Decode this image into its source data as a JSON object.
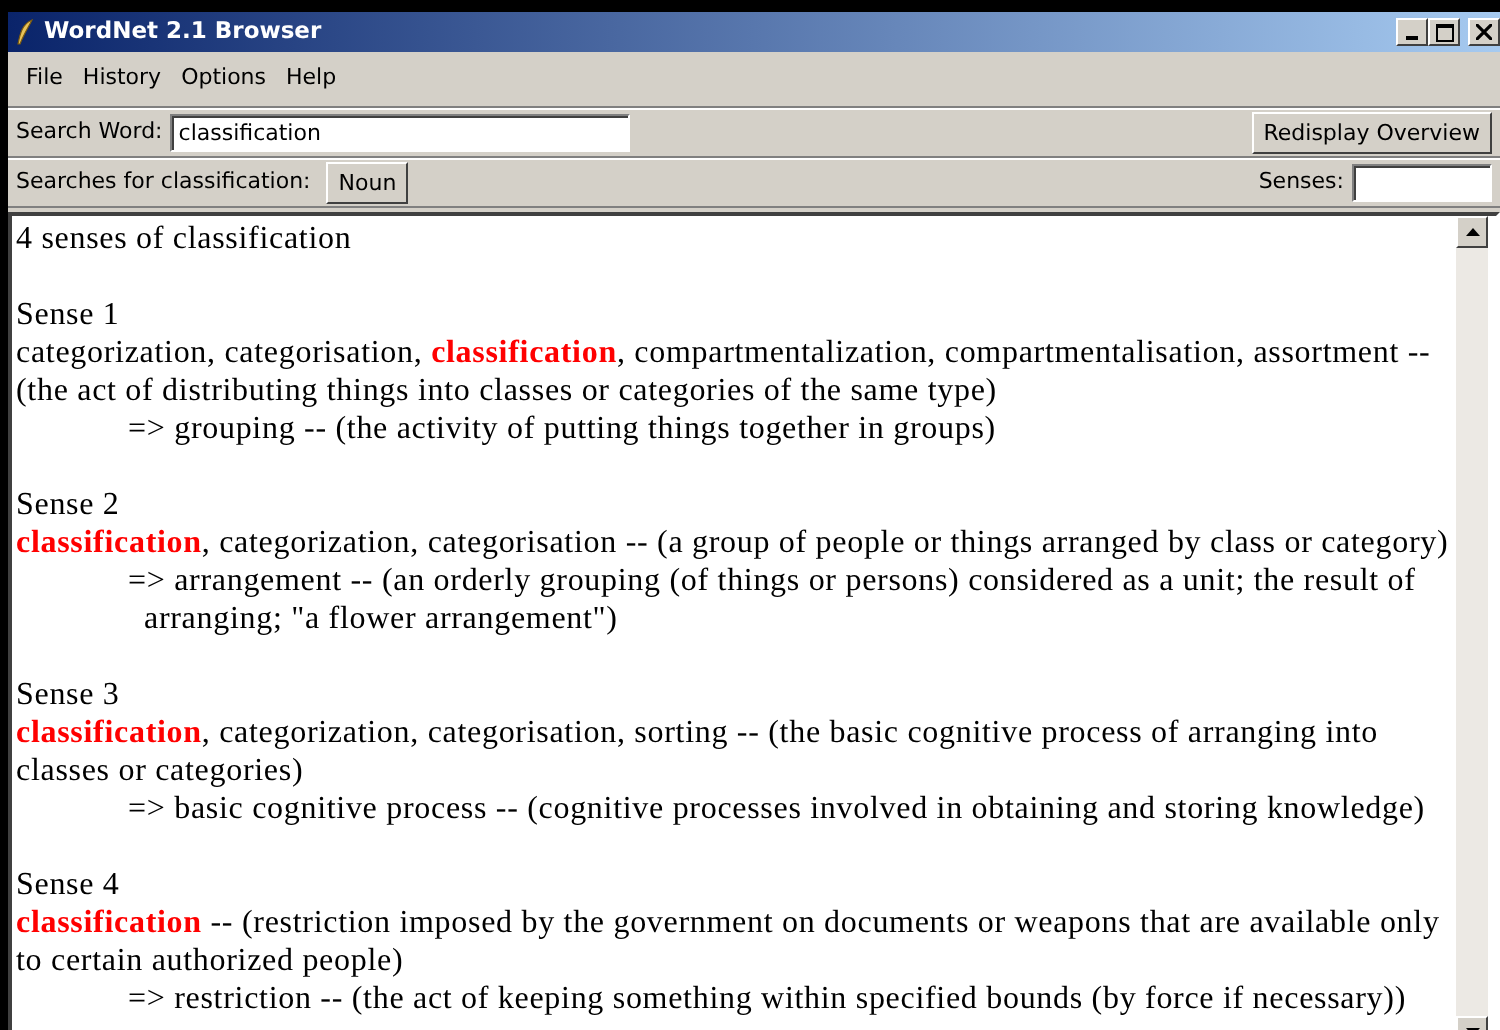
{
  "window": {
    "title": "WordNet 2.1 Browser"
  },
  "menu": [
    "File",
    "History",
    "Options",
    "Help"
  ],
  "search": {
    "label": "Search Word:",
    "value": "classification",
    "button": "Redisplay Overview"
  },
  "searches": {
    "label": "Searches for classification:",
    "buttons": [
      "Noun"
    ],
    "senses_label": "Senses:"
  },
  "content": {
    "heading": "4 senses of classification",
    "senses": [
      {
        "title": "Sense 1",
        "synset": "categorization, categorisation, **classification**, compartmentalization, compartmentalisation, assortment -- (the act of distributing things into classes or categories of the same type)",
        "hypernym": "=> grouping -- (the activity of putting things together in groups)"
      },
      {
        "title": "Sense 2",
        "synset": "**classification**, categorization, categorisation -- (a group of people or things arranged by class or category)",
        "hypernym": "=> arrangement -- (an orderly grouping (of things or persons) considered as a unit; the result of arranging; \"a flower arrangement\")"
      },
      {
        "title": "Sense 3",
        "synset": "**classification**, categorization, categorisation, sorting -- (the basic cognitive process of arranging into classes or categories)",
        "hypernym": "=> basic cognitive process -- (cognitive processes involved in obtaining and storing knowledge)"
      },
      {
        "title": "Sense 4",
        "synset": "**classification** -- (restriction imposed by the government on documents or weapons that are available only to certain authorized people)",
        "hypernym": "=> restriction -- (the act of keeping something within specified bounds (by force if necessary))"
      }
    ]
  }
}
